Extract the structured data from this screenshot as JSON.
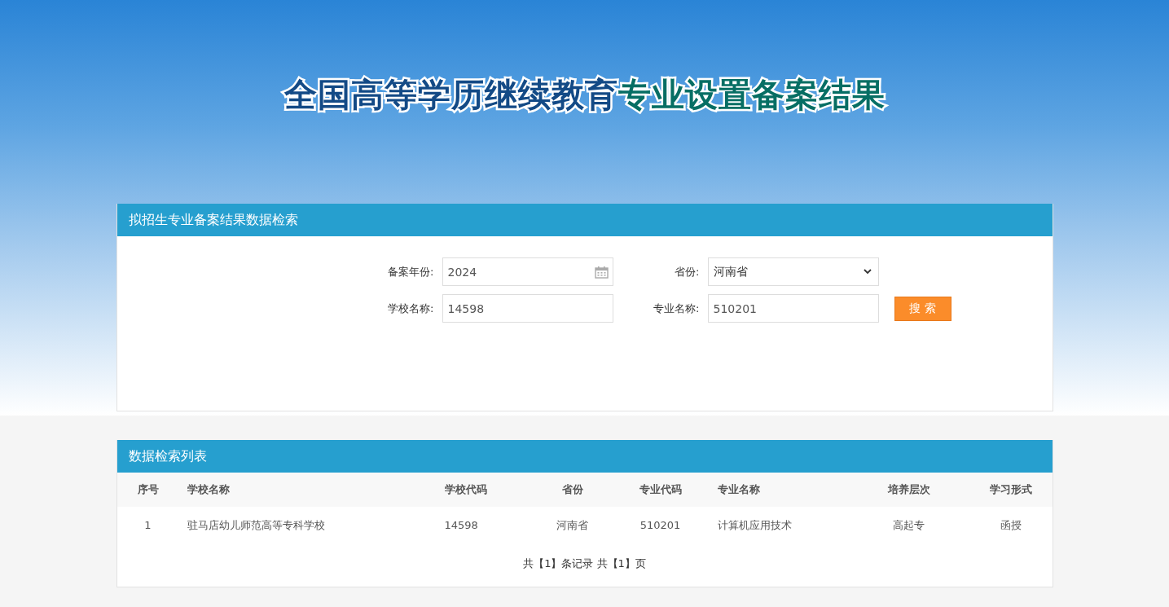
{
  "banner": {
    "title_part_1": "全国高等学历继续教育",
    "title_part_2": "专业设置备案结果"
  },
  "search_panel": {
    "title": "拟招生专业备案结果数据检索",
    "fields": [
      {
        "kind": "date",
        "label": "备案年份:",
        "value": "2024"
      },
      {
        "kind": "select",
        "label": "省份:",
        "value": "河南省"
      },
      {
        "kind": "text",
        "label": "学校名称:",
        "value": "14598"
      },
      {
        "kind": "text",
        "label": "专业名称:",
        "value": "510201"
      }
    ],
    "search_button": "搜 索"
  },
  "results_panel": {
    "title": "数据检索列表",
    "columns": [
      "序号",
      "学校名称",
      "学校代码",
      "省份",
      "专业代码",
      "专业名称",
      "培养层次",
      "学习形式"
    ],
    "rows": [
      [
        "1",
        "驻马店幼儿师范高等专科学校",
        "14598",
        "河南省",
        "510201",
        "计算机应用技术",
        "高起专",
        "函授"
      ]
    ],
    "pagination": "共【1】条记录 共【1】页"
  }
}
